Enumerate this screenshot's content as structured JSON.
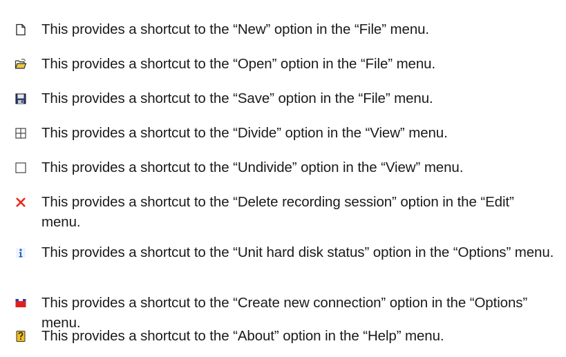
{
  "items": [
    {
      "icon": "new-document-icon",
      "text": "This provides a shortcut to the “New” option in the “File” menu."
    },
    {
      "icon": "open-folder-icon",
      "text": "This provides a shortcut to the “Open” option in the “File” menu."
    },
    {
      "icon": "save-disk-icon",
      "text": "This provides a shortcut to the “Save” option in the “File” menu."
    },
    {
      "icon": "divide-grid-icon",
      "text": "This provides a shortcut to the “Divide” option in the “View” menu."
    },
    {
      "icon": "undivide-square-icon",
      "text": "This provides a shortcut to the “Undivide” option in the “View” menu."
    },
    {
      "icon": "delete-x-icon",
      "text": "This provides a shortcut to the “Delete recording session” option in the “Edit” menu."
    },
    {
      "icon": "info-icon",
      "text": "This provides a shortcut to the “Unit hard disk status” option in the “Options” menu."
    },
    {
      "icon": "new-connection-icon",
      "text": "This provides a shortcut to the “Create new connection” option in the “Options” menu."
    },
    {
      "icon": "help-about-icon",
      "text": "This provides a shortcut to the “About” option in the “Help” menu."
    }
  ],
  "colors": {
    "text": "#1a1a1a",
    "delete_red": "#e8261b",
    "info_blue": "#1f5fbf",
    "connection_red": "#e02020",
    "connection_blue": "#1040c0",
    "help_yellow": "#f0c020",
    "folder_yellow": "#e8c840"
  }
}
